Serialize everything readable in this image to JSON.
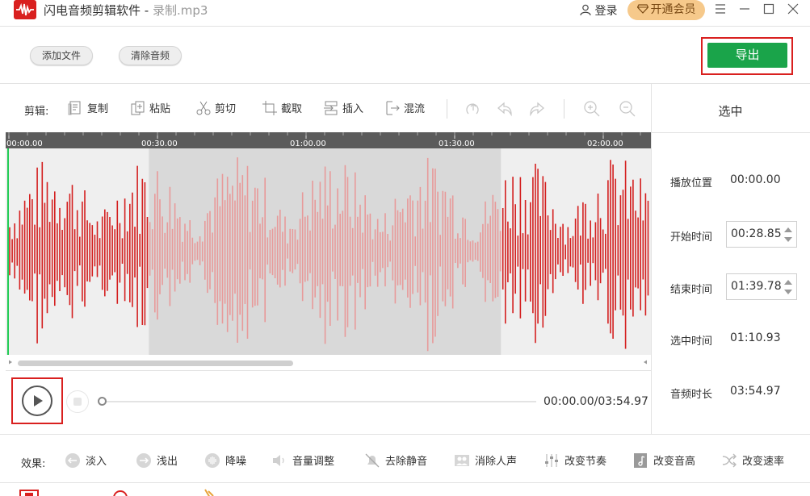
{
  "titlebar": {
    "app_name": "闪电音频剪辑软件 -",
    "file_name": "录制.mp3",
    "login_label": "登录",
    "vip_label": "开通会员"
  },
  "toolbar": {
    "add_file_label": "添加文件",
    "clear_audio_label": "清除音频",
    "export_label": "导出"
  },
  "edit_bar": {
    "label": "剪辑:",
    "tools": [
      {
        "name": "copy",
        "label": "复制"
      },
      {
        "name": "paste",
        "label": "粘贴"
      },
      {
        "name": "cut",
        "label": "剪切"
      },
      {
        "name": "crop",
        "label": "截取"
      },
      {
        "name": "insert",
        "label": "插入"
      },
      {
        "name": "mix",
        "label": "混流"
      }
    ]
  },
  "timeline": {
    "ticks": [
      "00:00.00",
      "00:30.00",
      "01:00.00",
      "01:30.00",
      "02:00.00"
    ]
  },
  "selection": {
    "start_seconds": 28.85,
    "end_seconds": 99.78,
    "visible_duration_seconds": 130
  },
  "panel": {
    "title": "选中",
    "play_position_label": "播放位置",
    "play_position_value": "00:00.00",
    "start_time_label": "开始时间",
    "start_time_value": "00:28.85",
    "end_time_label": "结束时间",
    "end_time_value": "01:39.78",
    "selected_time_label": "选中时间",
    "selected_time_value": "01:10.93",
    "duration_label": "音频时长",
    "duration_value": "03:54.97"
  },
  "playback": {
    "time_readout": "00:00.00/03:54.97",
    "progress": 0
  },
  "effects": {
    "label": "效果:",
    "items": [
      {
        "name": "fade-in",
        "label": "淡入"
      },
      {
        "name": "fade-out",
        "label": "浅出"
      },
      {
        "name": "denoise",
        "label": "降噪"
      },
      {
        "name": "volume",
        "label": "音量调整"
      },
      {
        "name": "remove-silence",
        "label": "去除静音"
      },
      {
        "name": "remove-vocals",
        "label": "消除人声"
      },
      {
        "name": "tempo",
        "label": "改变节奏"
      },
      {
        "name": "pitch",
        "label": "改变音高"
      },
      {
        "name": "speed",
        "label": "改变速率"
      }
    ]
  },
  "colors": {
    "accent_red": "#d9201f",
    "export_green": "#1aa44a",
    "wave_red": "#d41f1f",
    "wave_selected": "#e89a9a",
    "playhead_green": "#22cc55"
  }
}
